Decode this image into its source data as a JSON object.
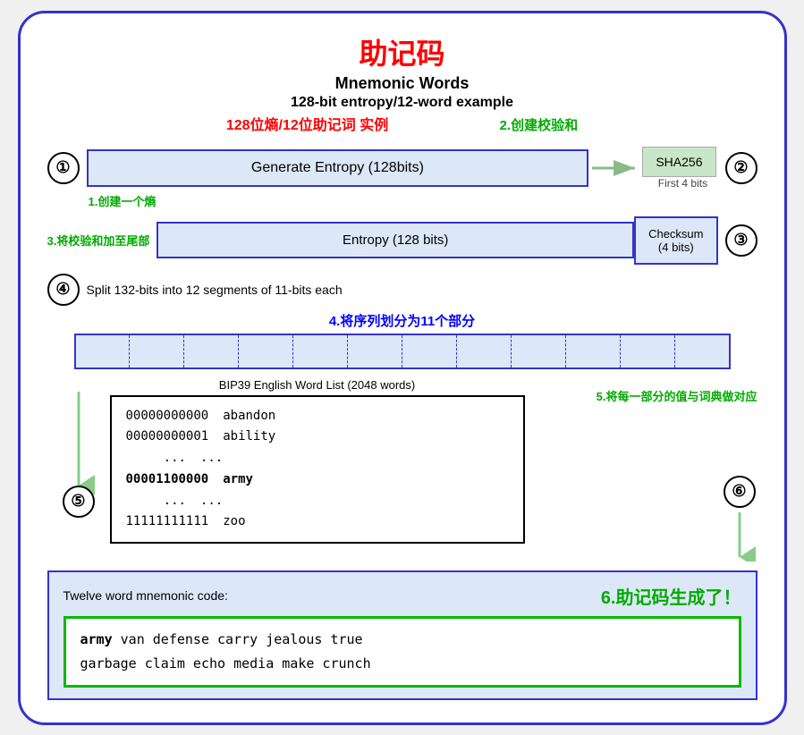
{
  "title": {
    "zh": "助记码",
    "en_main": "Mnemonic Words",
    "en_sub": "128-bit entropy/12-word example",
    "zh_sub": "128位熵/12位助记词 实例"
  },
  "labels": {
    "label1": "1.创建一个熵",
    "label2": "2.创建校验和",
    "label3": "3.将校验和加至尾部",
    "label4_main": "Split 132-bits into 12 segments of 11-bits each",
    "label4_zh": "4.将序列划分为11个部分",
    "label5": "5.将每一部分的值与词典做对应",
    "label6": "6.助记码生成了！"
  },
  "boxes": {
    "entropy_generate": "Generate Entropy (128bits)",
    "sha256": "SHA256",
    "first4bits": "First 4 bits",
    "entropy128": "Entropy (128 bits)",
    "checksum": "Checksum\n(4 bits)",
    "wordlist_title": "BIP39 English Word List (2048 words)",
    "twelve_word": "Twelve word mnemonic code:"
  },
  "wordlist": [
    {
      "binary": "00000000000",
      "word": "abandon"
    },
    {
      "binary": "00000000001",
      "word": "ability"
    },
    {
      "binary": "...",
      "word": "..."
    },
    {
      "binary": "00001100000",
      "word": "army",
      "bold": true
    },
    {
      "binary": "...",
      "word": "..."
    },
    {
      "binary": "11111111111",
      "word": "zoo"
    }
  ],
  "mnemonic": {
    "words": "army van defense carry jealous true garbage claim echo media make crunch",
    "bold_word": "army"
  },
  "circles": [
    "①",
    "②",
    "③",
    "④",
    "⑤",
    "⑥"
  ]
}
